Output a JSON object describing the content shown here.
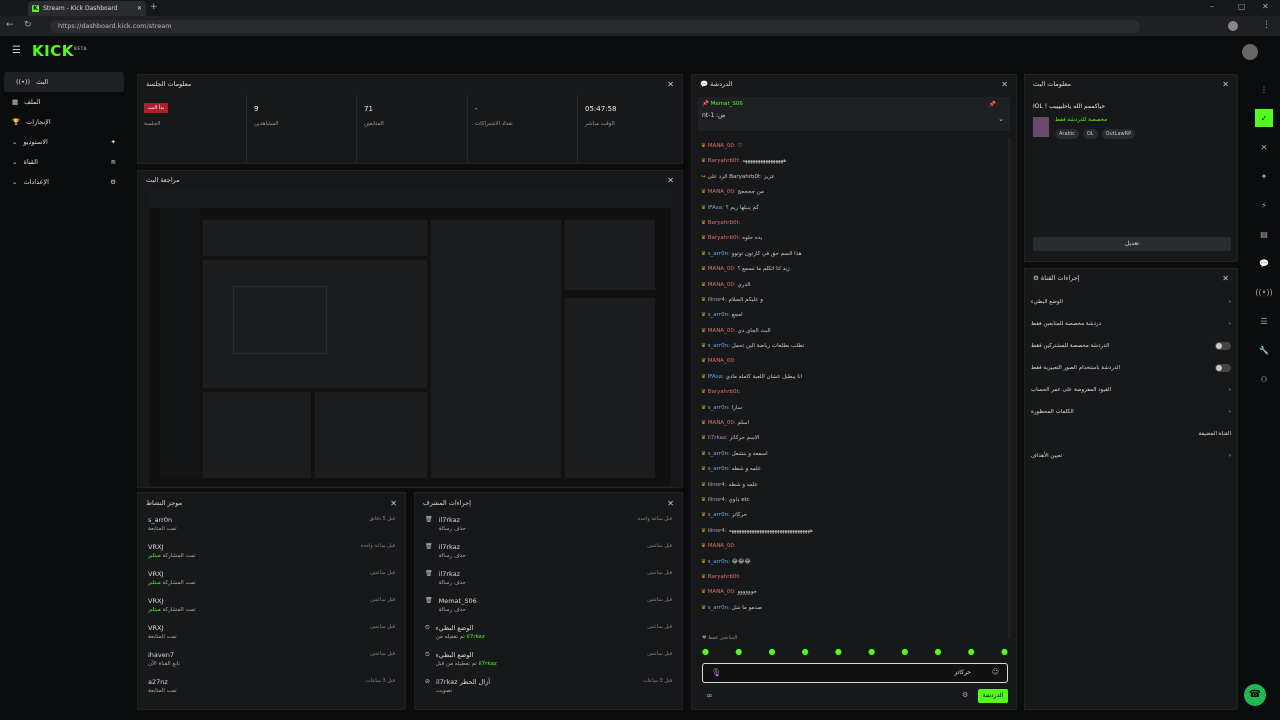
{
  "browser": {
    "tab_title": "Stream - Kick Dashboard",
    "url": "https://dashboard.kick.com/stream"
  },
  "logo": "KICK",
  "logo_beta": "BETA",
  "sidebar": {
    "items": [
      {
        "label": "البث",
        "icon": "broadcast-icon"
      },
      {
        "label": "الملف",
        "icon": "file-icon"
      },
      {
        "label": "الإنجازات",
        "icon": "trophy-icon"
      },
      {
        "label": "الاستوديو",
        "icon": "chevron-down-icon"
      },
      {
        "label": "القناة",
        "icon": "chevron-down-icon"
      },
      {
        "label": "الإعدادات",
        "icon": "chevron-down-icon"
      }
    ]
  },
  "session": {
    "title": "معلومات الجلسة",
    "badge": "بدأ البث",
    "badge_label": "الجلسة",
    "stats": [
      {
        "value": "9",
        "label": "المشاهدين"
      },
      {
        "value": "71",
        "label": "المتابعين"
      },
      {
        "value": "-",
        "label": "تعداد الاشتراكات"
      },
      {
        "value": "05:47:58",
        "label": "الوقت مباشر"
      }
    ]
  },
  "preview": {
    "title": "مراجعة البث"
  },
  "activity": {
    "title": "موجز النشاط",
    "rows": [
      {
        "name": "s_arr0n",
        "sub": "تمت المتابعة",
        "tag": "قبل 5 دقائق",
        "time": "قبل 5 دقائق"
      },
      {
        "name": "VRXJ",
        "sub": "تمت المشاركة",
        "tag": "مبتلبر",
        "time": "قبل ساعة واحدة"
      },
      {
        "name": "VRXJ",
        "sub": "تمت المشاركة",
        "tag": "مبتلبر",
        "time": "قبل ساعتين"
      },
      {
        "name": "VRXJ",
        "sub": "تمت المشاركة",
        "tag": "مبتلبر",
        "time": "قبل ساعتين"
      },
      {
        "name": "VRXJ",
        "sub": "تمت المتابعة",
        "tag": "",
        "time": "قبل ساعتين"
      },
      {
        "name": "ihaven7",
        "sub": "تابع القناة الآن",
        "tag": "",
        "time": "قبل ساعتين"
      },
      {
        "name": "a27nz",
        "sub": "تمت المتابعة",
        "tag": "",
        "time": "قبل 3 ساعات"
      }
    ]
  },
  "modactions": {
    "title": "إجراءات المشرف",
    "rows": [
      {
        "name": "il7rkaz",
        "sub": "حذف رسالة",
        "time": "قبل ساعة واحدة"
      },
      {
        "name": "il7rkaz",
        "sub": "حذف رسالة",
        "time": "قبل ساعتين"
      },
      {
        "name": "il7rkaz",
        "sub": "حذف رسالة",
        "time": "قبل ساعتين"
      },
      {
        "name": "Memat_S06",
        "sub": "حذف رسالة",
        "time": "قبل ساعتين"
      },
      {
        "name": "الوضع البطيء",
        "sub": "تم تفعيله من",
        "tag": "il7rkaz",
        "time": "قبل ساعتين"
      },
      {
        "name": "الوضع البطيء",
        "sub": "تم تعطيله من قبل",
        "tag": "il7rkaz",
        "time": "قبل ساعتين"
      },
      {
        "name": "il7rkaz",
        "sub": "أزال الحظر",
        "tag": "تصويت",
        "time": "قبل 3 ساعات"
      }
    ]
  },
  "chat": {
    "title": "الدردشة",
    "pinned_user": "Memat_S06",
    "pinned_text": "nt-1 :ض",
    "lines": [
      {
        "user": "MANA_00:",
        "color": "u1",
        "text": "♡"
      },
      {
        "user": "Baryahrb0t:",
        "color": "u1",
        "text": "ههههههههههههههههه"
      },
      {
        "user": "",
        "color": "u4",
        "text": "الرد على Baryahrb0t: عزيز"
      },
      {
        "user": "MANA_00:",
        "color": "u1",
        "text": "من ججججج"
      },
      {
        "user": "IFAsa:",
        "color": "u2",
        "text": "كم ينبلها ريم ؟"
      },
      {
        "user": "Baryahrb0t:",
        "color": "u1",
        "text": ""
      },
      {
        "user": "Baryahrb0t:",
        "color": "u1",
        "text": "يده حلوه"
      },
      {
        "user": "s_arr0n:",
        "color": "u2",
        "text": "هذا السم حق في كارتون توتوو"
      },
      {
        "user": "MANA_00:",
        "color": "u1",
        "text": "زيد انا اتكلم ما تسمع ؟"
      },
      {
        "user": "MANA_00:",
        "color": "u1",
        "text": "الدري"
      },
      {
        "user": "ilinor4:",
        "color": "u4",
        "text": "و عليكم السلام"
      },
      {
        "user": "s_arr0n:",
        "color": "u2",
        "text": "امجع"
      },
      {
        "user": "MANA_00:",
        "color": "u1",
        "text": "البث الجاي دي"
      },
      {
        "user": "s_arr0n:",
        "color": "u2",
        "text": "تطلب بطلعات رياضة الين تحمل"
      },
      {
        "user": "MANA_00:",
        "color": "u1",
        "text": ""
      },
      {
        "user": "IFAsa:",
        "color": "u2",
        "text": "انا يبطيل عشان اللعبة كامله مادي"
      },
      {
        "user": "Baryahrb0t:",
        "color": "u1",
        "text": ""
      },
      {
        "user": "s_arr0n:",
        "color": "u2",
        "text": "سارا"
      },
      {
        "user": "MANA_00:",
        "color": "u1",
        "text": "اسلم"
      },
      {
        "user": "il7rkaz:",
        "color": "u5",
        "text": "الاسم حركاتز"
      },
      {
        "user": "s_arr0n:",
        "color": "u2",
        "text": "اسمعه و بتشعل"
      },
      {
        "user": "s_arr0n:",
        "color": "u2",
        "text": "علمه و شطه"
      },
      {
        "user": "ilinor4:",
        "color": "u4",
        "text": "علمه و شطه"
      },
      {
        "user": "ilinor4:",
        "color": "u4",
        "text": "داوي etc"
      },
      {
        "user": "s_arr0n:",
        "color": "u2",
        "text": "حركاتز"
      },
      {
        "user": "ilinor4:",
        "color": "u4",
        "text": "ههههههههههههههههههههههههههههههههه"
      },
      {
        "user": "MANA_00:",
        "color": "u1",
        "text": ""
      },
      {
        "user": "s_arr0n:",
        "color": "u2",
        "text": "😂😂😂"
      },
      {
        "user": "Baryahrb0t:",
        "color": "u1",
        "text": ""
      },
      {
        "user": "MANA_00:",
        "color": "u1",
        "text": "جوووووو"
      },
      {
        "user": "s_arr0n:",
        "color": "u2",
        "text": "صدمو ما شل"
      }
    ],
    "followers_only": "المتابعين فقط",
    "input_value": "حركاتز",
    "send": "الدردشة"
  },
  "streaminfo": {
    "title": "معلومات البث",
    "stream_title": "IOL ! حياكممم الله ياحلييييب",
    "category": "مخصصة للدردشة فقط",
    "tags": [
      "Arabic",
      "OL",
      "OutLawRP"
    ],
    "edit": "تعديل"
  },
  "channelactions": {
    "title": "إجراءات القناة",
    "rows": [
      {
        "label": "الوضع البطيء",
        "type": "arrow"
      },
      {
        "label": "دردشة مخصصة للمتابعين فقط",
        "type": "arrow"
      },
      {
        "label": "الدردشة مخصصة للمشتركين فقط",
        "type": "toggle"
      },
      {
        "label": "الدردشة باستخدام الصور التعبيرية فقط",
        "type": "toggle"
      },
      {
        "label": "القيود المفروضة على عمر الحساب",
        "type": "arrow"
      },
      {
        "label": "الكلمات المحظورة",
        "type": "arrow"
      },
      {
        "label": "القناة المضيفة",
        "type": "none"
      },
      {
        "label": "تعيين الأهداف",
        "type": "arrow"
      }
    ]
  }
}
